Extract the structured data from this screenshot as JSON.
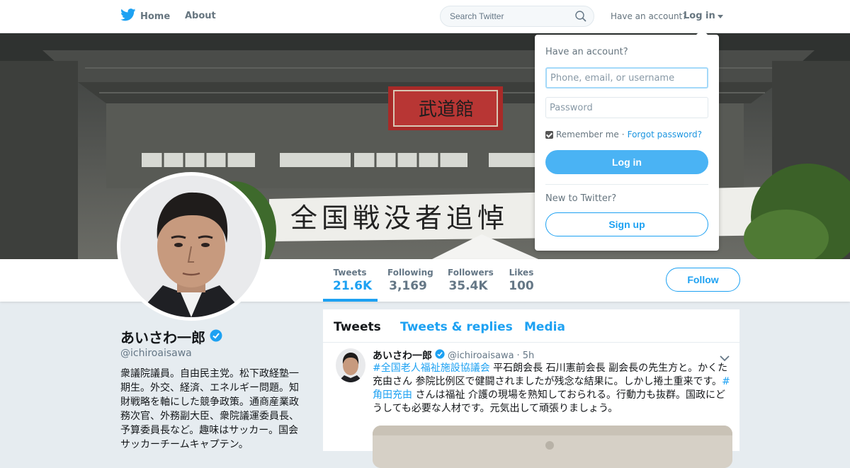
{
  "nav": {
    "home_label": "Home",
    "about_label": "About",
    "search_placeholder": "Search Twitter",
    "have_account": "Have an account?",
    "login_label": "Log in"
  },
  "banner": {
    "sign_text": "武道館",
    "banner_text": "全国戦没者追悼"
  },
  "stats": [
    {
      "label": "Tweets",
      "value": "21.6K"
    },
    {
      "label": "Following",
      "value": "3,169"
    },
    {
      "label": "Followers",
      "value": "35.4K"
    },
    {
      "label": "Likes",
      "value": "100"
    }
  ],
  "follow_label": "Follow",
  "profile": {
    "name": "あいさわ一郎",
    "handle": "@ichiroaisawa",
    "bio": "衆議院議員。自由民主党。松下政経塾一期生。外交、経済、エネルギー問題。知財戦略を軸にした競争政策。通商産業政務次官、外務副大臣、衆院議運委員長、予算委員長など。趣味はサッカー。国会サッカーチームキャプテン。"
  },
  "timeline": {
    "tabs": [
      "Tweets",
      "Tweets & replies",
      "Media"
    ],
    "tweet": {
      "name": "あいさわ一郎",
      "handle": "@ichiroaisawa",
      "dot": "·",
      "time": "5h",
      "hashtag1": "#全国老人福祉施設協議会",
      "text1": " 平石朗会長 石川憲前会長 副会長の先生方と。かくた充由さん 参院比例区で健闘されましたが残念な結果に。しかし捲土重来です。",
      "hashtag2": "#角田充由",
      "text2": " さんは福祉 介護の現場を熟知しておられる。行動力も抜群。国政にどうしても必要な人材です。元気出して頑張りましょう。"
    }
  },
  "login_dropdown": {
    "title": "Have an account?",
    "username_placeholder": "Phone, email, or username",
    "password_placeholder": "Password",
    "remember_label": "Remember me",
    "separator": "·",
    "forgot_label": "Forgot password?",
    "login_button": "Log in",
    "new_label": "New to Twitter?",
    "signup_button": "Sign up"
  },
  "colors": {
    "accent": "#1da1f2",
    "login_button": "#4ab3f4",
    "muted": "#657786",
    "background": "#e6ecf0"
  }
}
